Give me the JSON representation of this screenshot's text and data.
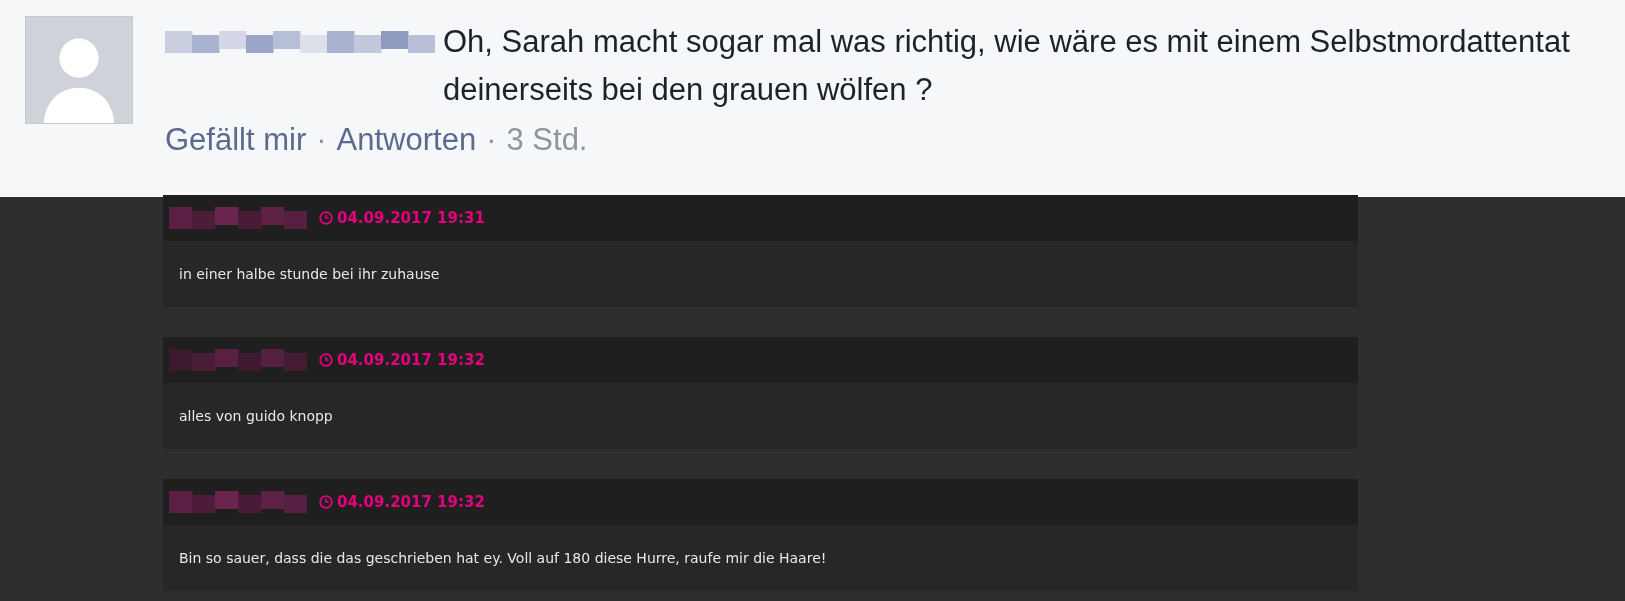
{
  "comment": {
    "text": "Oh, Sarah macht sogar mal was richtig, wie wäre es mit einem Selbstmordattentat deinerseits bei den grauen wölfen ?",
    "actions": [
      {
        "kind": "link",
        "label": "Gefällt mir"
      },
      {
        "kind": "separator",
        "label": "·"
      },
      {
        "kind": "link",
        "label": "Antworten"
      },
      {
        "kind": "separator",
        "label": "·"
      },
      {
        "kind": "time",
        "label": "3 Std."
      }
    ]
  },
  "posts": [
    {
      "timestamp": "04.09.2017 19:31",
      "text": "in einer halbe stunde bei ihr zuhause"
    },
    {
      "timestamp": "04.09.2017 19:32",
      "text": "alles von guido knopp"
    },
    {
      "timestamp": "04.09.2017 19:32",
      "text": "Bin so sauer, dass die das geschrieben hat ey. Voll auf 180 diese Hurre, raufe mir die Haare!"
    }
  ]
}
